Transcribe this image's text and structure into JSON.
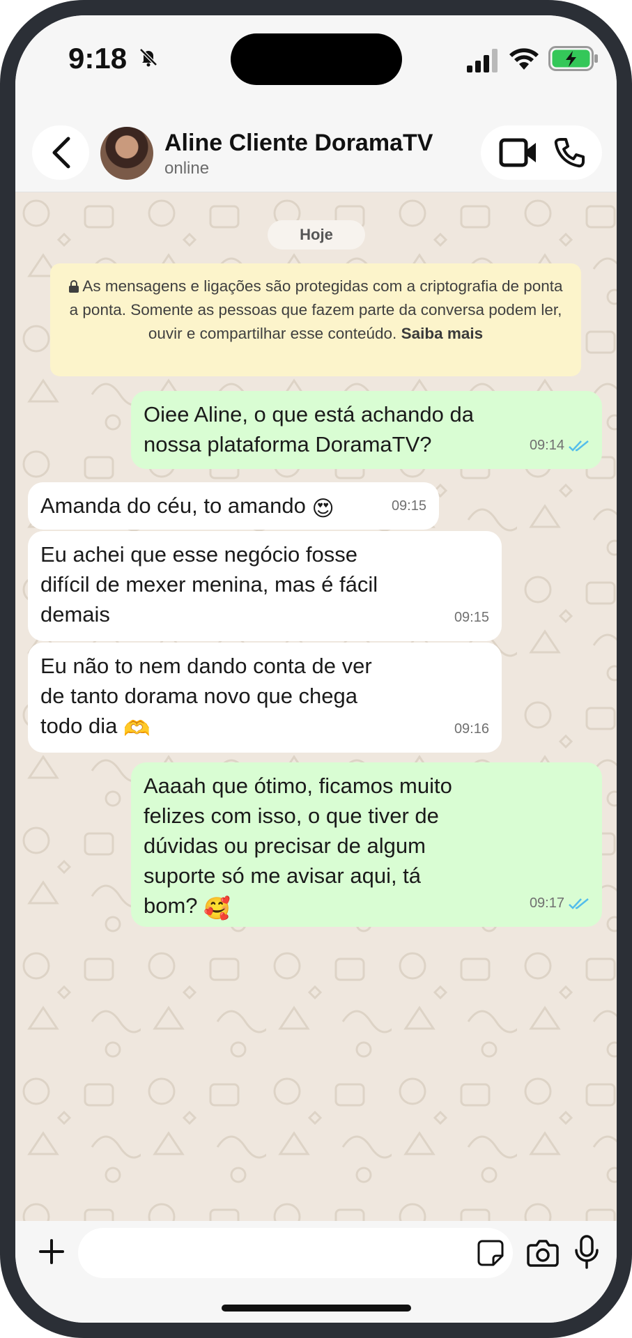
{
  "status_bar": {
    "time": "9:18",
    "icons": [
      "bell-slash-icon",
      "signal-icon",
      "wifi-icon",
      "battery-charging-icon"
    ]
  },
  "header": {
    "contact_name": "Aline Cliente DoramaTV",
    "contact_status": "online",
    "icons": [
      "back-icon",
      "video-call-icon",
      "phone-icon"
    ]
  },
  "chat": {
    "date_label": "Hoje",
    "encryption_notice": {
      "text": "As mensagens e ligações são protegidas com a criptografia de ponta a ponta. Somente as pessoas que fazem parte da conversa podem ler, ouvir e compartilhar esse conteúdo.",
      "link": "Saiba mais"
    },
    "messages": [
      {
        "direction": "outgoing",
        "lines": [
          "Oiee Aline, o que está achando da",
          "nossa plataforma DoramaTV?"
        ],
        "time": "09:14",
        "read": true
      },
      {
        "direction": "incoming",
        "lines": [
          "Amanda do céu, to amando"
        ],
        "emoji": "😍",
        "time": "09:15"
      },
      {
        "direction": "incoming",
        "lines": [
          "Eu achei que esse negócio fosse",
          "difícil de mexer menina, mas é fácil",
          "demais"
        ],
        "time": "09:15"
      },
      {
        "direction": "incoming",
        "lines": [
          "Eu não to nem dando conta de ver",
          "de tanto dorama novo que chega",
          "todo dia"
        ],
        "emoji": "🫶",
        "time": "09:16"
      },
      {
        "direction": "outgoing",
        "lines": [
          "Aaaah que ótimo, ficamos muito",
          "felizes com isso, o que tiver de",
          "dúvidas ou precisar de algum",
          "suporte só me avisar aqui, tá",
          "bom?"
        ],
        "emoji": "🥰",
        "time": "09:17",
        "read": true
      }
    ]
  },
  "composer": {
    "input_value": "",
    "icons": [
      "plus-icon",
      "sticker-icon",
      "camera-icon",
      "microphone-icon"
    ]
  },
  "colors": {
    "outgoing_bubble": "#d9fdd3",
    "incoming_bubble": "#ffffff",
    "chat_background": "#efe7de",
    "notice_background": "#fcf4cb",
    "read_tick": "#53bdeb",
    "battery_fill": "#34c759"
  }
}
